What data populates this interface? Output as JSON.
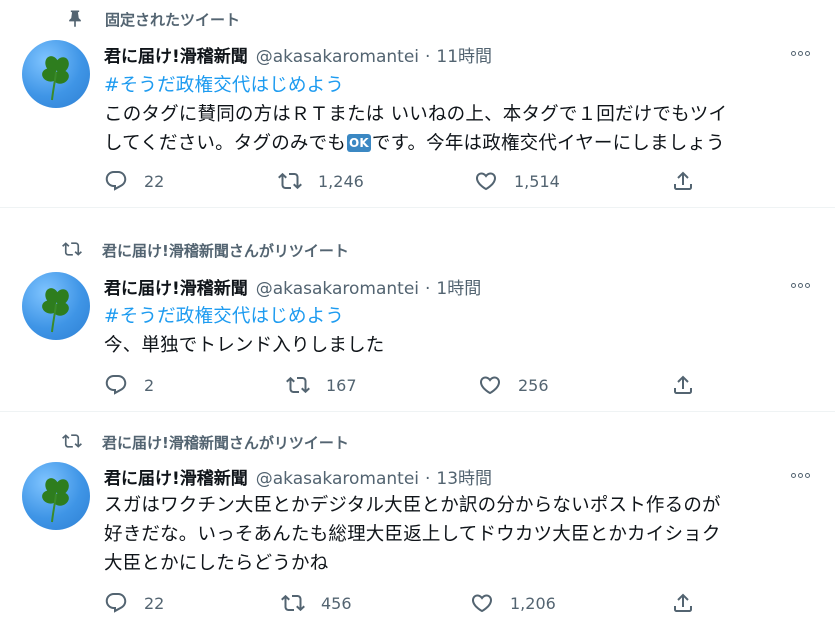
{
  "tweets": [
    {
      "context": "固定されたツイート",
      "name": "君に届け!滑稽新聞",
      "handle": "@akasakaromantei",
      "dot": "·",
      "time": "11時間",
      "hashtag": "#そうだ政権交代はじめよう",
      "line1": "このタグに賛同の方はＲＴまたは いいねの上、本タグで１回だけでもツイ",
      "line2a": "してください。タグのみでも",
      "ok": "OK",
      "line2b": "です。今年は政権交代イヤーにしましょう",
      "replies": "22",
      "retweets": "1,246",
      "likes": "1,514"
    },
    {
      "context": "君に届け!滑稽新聞さんがリツイート",
      "name": "君に届け!滑稽新聞",
      "handle": "@akasakaromantei",
      "dot": "·",
      "time": "1時間",
      "hashtag": "#そうだ政権交代はじめよう",
      "line1": "今、単独でトレンド入りしました",
      "replies": "2",
      "retweets": "167",
      "likes": "256"
    },
    {
      "context": "君に届け!滑稽新聞さんがリツイート",
      "name": "君に届け!滑稽新聞",
      "handle": "@akasakaromantei",
      "dot": "·",
      "time": "13時間",
      "line1": "スガはワクチン大臣とかデジタル大臣とか訳の分からないポスト作るのが",
      "line2": "好きだな。いっそあんたも総理大臣返上してドウカツ大臣とかカイショク",
      "line3": "大臣とかにしたらどうかね",
      "replies": "22",
      "retweets": "456",
      "likes": "1,206"
    }
  ],
  "icons": {
    "pin": "pin-icon",
    "retweet_context": "retweet-icon",
    "reply": "reply-icon",
    "retweet": "retweet-icon",
    "like": "heart-icon",
    "share": "share-icon",
    "more": "more-icon"
  },
  "colors": {
    "accent": "#1d9bf0",
    "secondary_text": "#536471",
    "primary_text": "#0f1419"
  }
}
